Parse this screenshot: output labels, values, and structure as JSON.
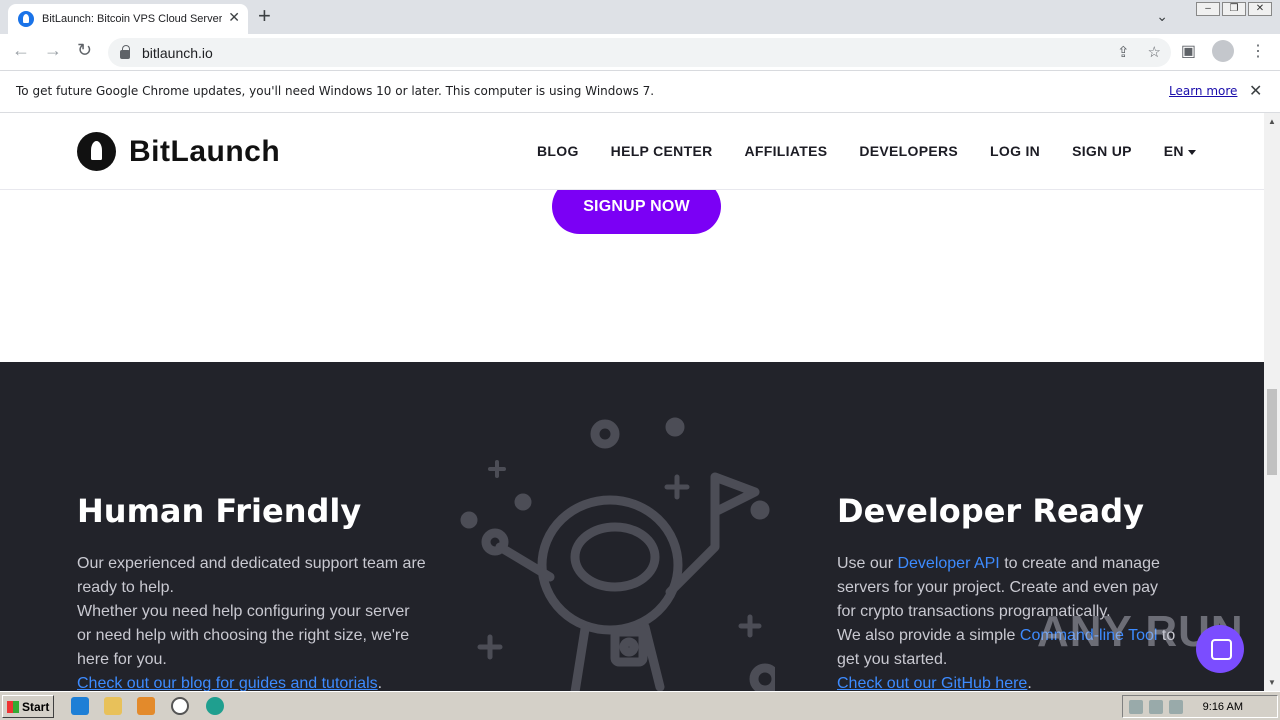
{
  "browser": {
    "tab_title": "BitLaunch: Bitcoin VPS Cloud Servers",
    "tab_close": "✕",
    "new_tab": "+",
    "url": "bitlaunch.io",
    "infobar_message": "To get future Google Chrome updates, you'll need Windows 10 or later. This computer is using Windows 7.",
    "infobar_link": "Learn more",
    "infobar_close": "✕"
  },
  "site": {
    "logo_name": "BitLaunch",
    "nav": [
      "BLOG",
      "HELP CENTER",
      "AFFILIATES",
      "DEVELOPERS",
      "LOG IN",
      "SIGN UP",
      "EN"
    ],
    "signup_button": "SIGNUP NOW",
    "left": {
      "title": "Human Friendly",
      "p1": "Our experienced and dedicated support team are ready to help.",
      "p2": "Whether you need help configuring your server or need help with choosing the right size, we're here for you.",
      "link": "Check out our blog for guides and tutorials",
      "link_suffix": "."
    },
    "right": {
      "title": "Developer Ready",
      "p1_pre": "Use our ",
      "p1_link": "Developer API",
      "p1_post": " to create and manage servers for your project. Create and even pay for crypto transactions programatically.",
      "p2_pre": "We also provide a simple ",
      "p2_link": "Command-line Tool",
      "p2_post": " to get you started.",
      "link": "Check out our GitHub here",
      "link_suffix": "."
    },
    "watermark": "ANY RUN"
  },
  "taskbar": {
    "start": "Start",
    "clock": "9:16 AM"
  },
  "colors": {
    "accent": "#7b00f5",
    "dark_bg": "#22232a",
    "link": "#3d8bff"
  }
}
